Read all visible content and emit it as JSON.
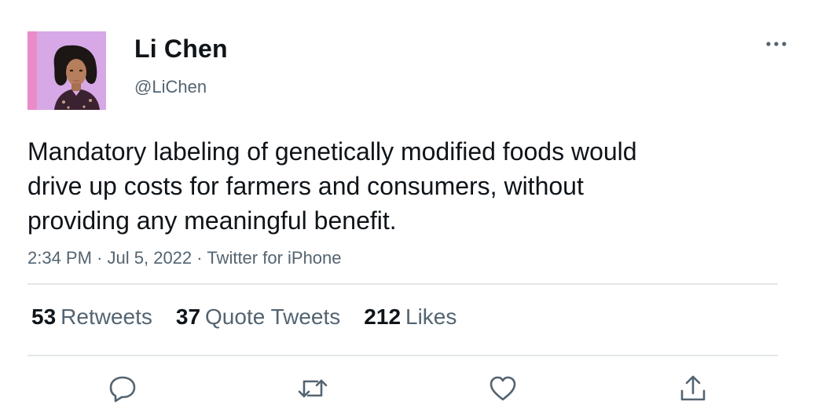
{
  "author": {
    "display_name": "Li Chen",
    "handle": "@LiChen",
    "avatar_icon": "profile-photo"
  },
  "tweet": {
    "text": "Mandatory labeling of genetically modified foods would\ndrive up costs for farmers and consumers, without\nproviding any meaningful benefit.",
    "time": "2:34 PM",
    "date": "Jul 5, 2022",
    "source": "Twitter for iPhone",
    "separator": "·"
  },
  "stats": {
    "retweets": {
      "count": "53",
      "label": "Retweets"
    },
    "quote_tweets": {
      "count": "37",
      "label": "Quote Tweets"
    },
    "likes": {
      "count": "212",
      "label": "Likes"
    }
  },
  "actions": {
    "reply_icon": "speech-bubble",
    "retweet_icon": "retweet-arrows",
    "like_icon": "heart",
    "share_icon": "upload-arrow"
  },
  "colors": {
    "text_primary": "#0f1419",
    "text_secondary": "#536471",
    "divider": "#e3e7ea",
    "avatar_background": "#d8a2e0"
  }
}
